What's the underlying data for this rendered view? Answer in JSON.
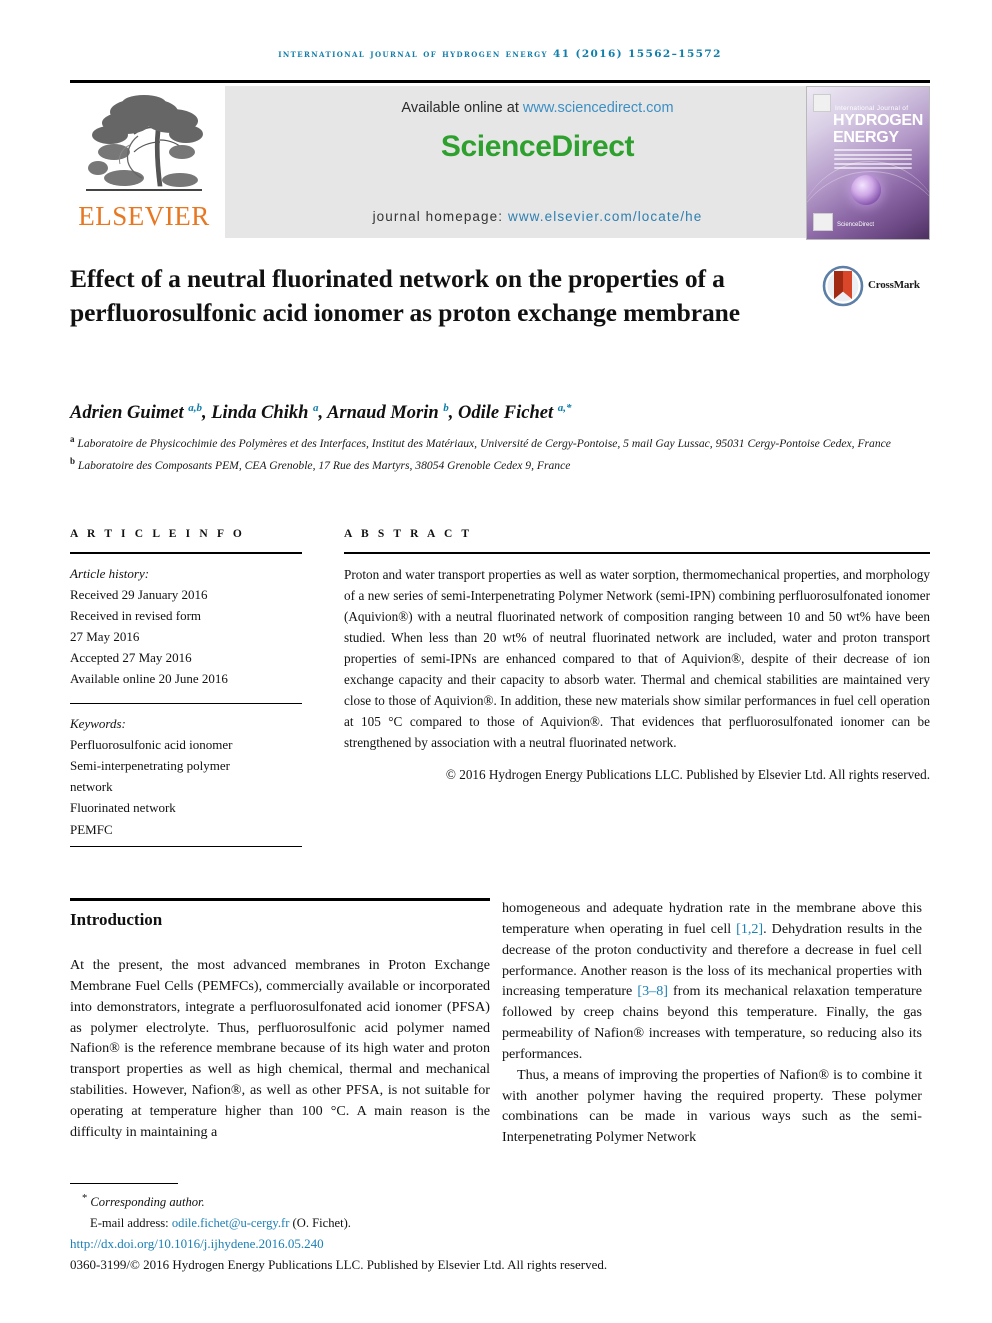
{
  "running_head": "international journal of hydrogen energy 41 (2016) 15562–15572",
  "masthead": {
    "publisher_name": "ELSEVIER",
    "available_prefix": "Available online at ",
    "available_url": "www.sciencedirect.com",
    "sciencedirect_logo": "ScienceDirect",
    "homepage_prefix": "journal homepage: ",
    "homepage_url": "www.elsevier.com/locate/he",
    "cover": {
      "line_small": "International Journal of",
      "line1": "HYDROGEN",
      "line2": "ENERGY",
      "sciencedirect": "ScienceDirect"
    }
  },
  "article": {
    "title": "Effect of a neutral fluorinated network on the properties of a perfluorosulfonic acid ionomer as proton exchange membrane",
    "crossmark_label": "CrossMark",
    "authors_html": "Adrien Guimet <sup>a,b</sup>, Linda Chikh <sup>a</sup>, Arnaud Morin <sup>b</sup>, Odile Fichet <sup>a,*</sup>",
    "affiliation_a": "Laboratoire de Physicochimie des Polymères et des Interfaces, Institut des Matériaux, Université de Cergy-Pontoise, 5 mail Gay Lussac, 95031 Cergy-Pontoise Cedex, France",
    "affiliation_b": "Laboratoire des Composants PEM, CEA Grenoble, 17 Rue des Martyrs, 38054 Grenoble Cedex 9, France"
  },
  "article_info": {
    "heading": "A R T I C L E   I N F O",
    "history_label": "Article history:",
    "received": "Received 29 January 2016",
    "revised_label": "Received in revised form",
    "revised_date": "27 May 2016",
    "accepted": "Accepted 27 May 2016",
    "available_online": "Available online 20 June 2016",
    "keywords_label": "Keywords:",
    "keywords": [
      "Perfluorosulfonic acid ionomer",
      "Semi-interpenetrating polymer",
      "network",
      "Fluorinated network",
      "PEMFC"
    ]
  },
  "abstract": {
    "heading": "A B S T R A C T",
    "body": "Proton and water transport properties as well as water sorption, thermomechanical properties, and morphology of a new series of semi-Interpenetrating Polymer Network (semi-IPN) combining perfluorosulfonated ionomer (Aquivion®) with a neutral fluorinated network of composition ranging between 10 and 50 wt% have been studied. When less than 20 wt% of neutral fluorinated network are included, water and proton transport properties of semi-IPNs are enhanced compared to that of Aquivion®, despite of their decrease of ion exchange capacity and their capacity to absorb water. Thermal and chemical stabilities are maintained very close to those of Aquivion®. In addition, these new materials show similar performances in fuel cell operation at 105 °C compared to those of Aquivion®. That evidences that perfluorosulfonated ionomer can be strengthened by association with a neutral fluorinated network.",
    "copyright": "© 2016 Hydrogen Energy Publications LLC. Published by Elsevier Ltd. All rights reserved."
  },
  "introduction": {
    "heading": "Introduction",
    "left_paragraph": "At the present, the most advanced membranes in Proton Exchange Membrane Fuel Cells (PEMFCs), commercially available or incorporated into demonstrators, integrate a perfluorosulfonated acid ionomer (PFSA) as polymer electrolyte. Thus, perfluorosulfonic acid polymer named Nafion® is the reference membrane because of its high water and proton transport properties as well as high chemical, thermal and mechanical stabilities. However, Nafion®, as well as other PFSA, is not suitable for operating at temperature higher than 100 °C. A main reason is the difficulty in maintaining a",
    "right_paragraph_1_a": "homogeneous and adequate hydration rate in the membrane above this temperature when operating in fuel cell ",
    "right_ref_1": "[1,2]",
    "right_paragraph_1_b": ". Dehydration results in the decrease of the proton conductivity and therefore a decrease in fuel cell performance. Another reason is the loss of its mechanical properties with increasing temperature ",
    "right_ref_2": "[3–8]",
    "right_paragraph_1_c": " from its mechanical relaxation temperature followed by creep chains beyond this temperature. Finally, the gas permeability of Nafion® increases with temperature, so reducing also its performances.",
    "right_paragraph_2": "Thus, a means of improving the properties of Nafion® is to combine it with another polymer having the required property. These polymer combinations can be made in various ways such as the semi-Interpenetrating Polymer Network"
  },
  "footer": {
    "corresponding_marker": "*",
    "corresponding_text": "Corresponding author.",
    "email_label": "E-mail address: ",
    "email": "odile.fichet@u-cergy.fr",
    "email_suffix": " (O. Fichet).",
    "doi": "http://dx.doi.org/10.1016/j.ijhydene.2016.05.240",
    "issn_line": "0360-3199/© 2016 Hydrogen Energy Publications LLC. Published by Elsevier Ltd. All rights reserved."
  },
  "colors": {
    "link": "#1a7fb5",
    "journal_head": "#0f7eab",
    "elsevier_orange": "#E87722",
    "sciencedirect_green": "#2ea02e"
  }
}
